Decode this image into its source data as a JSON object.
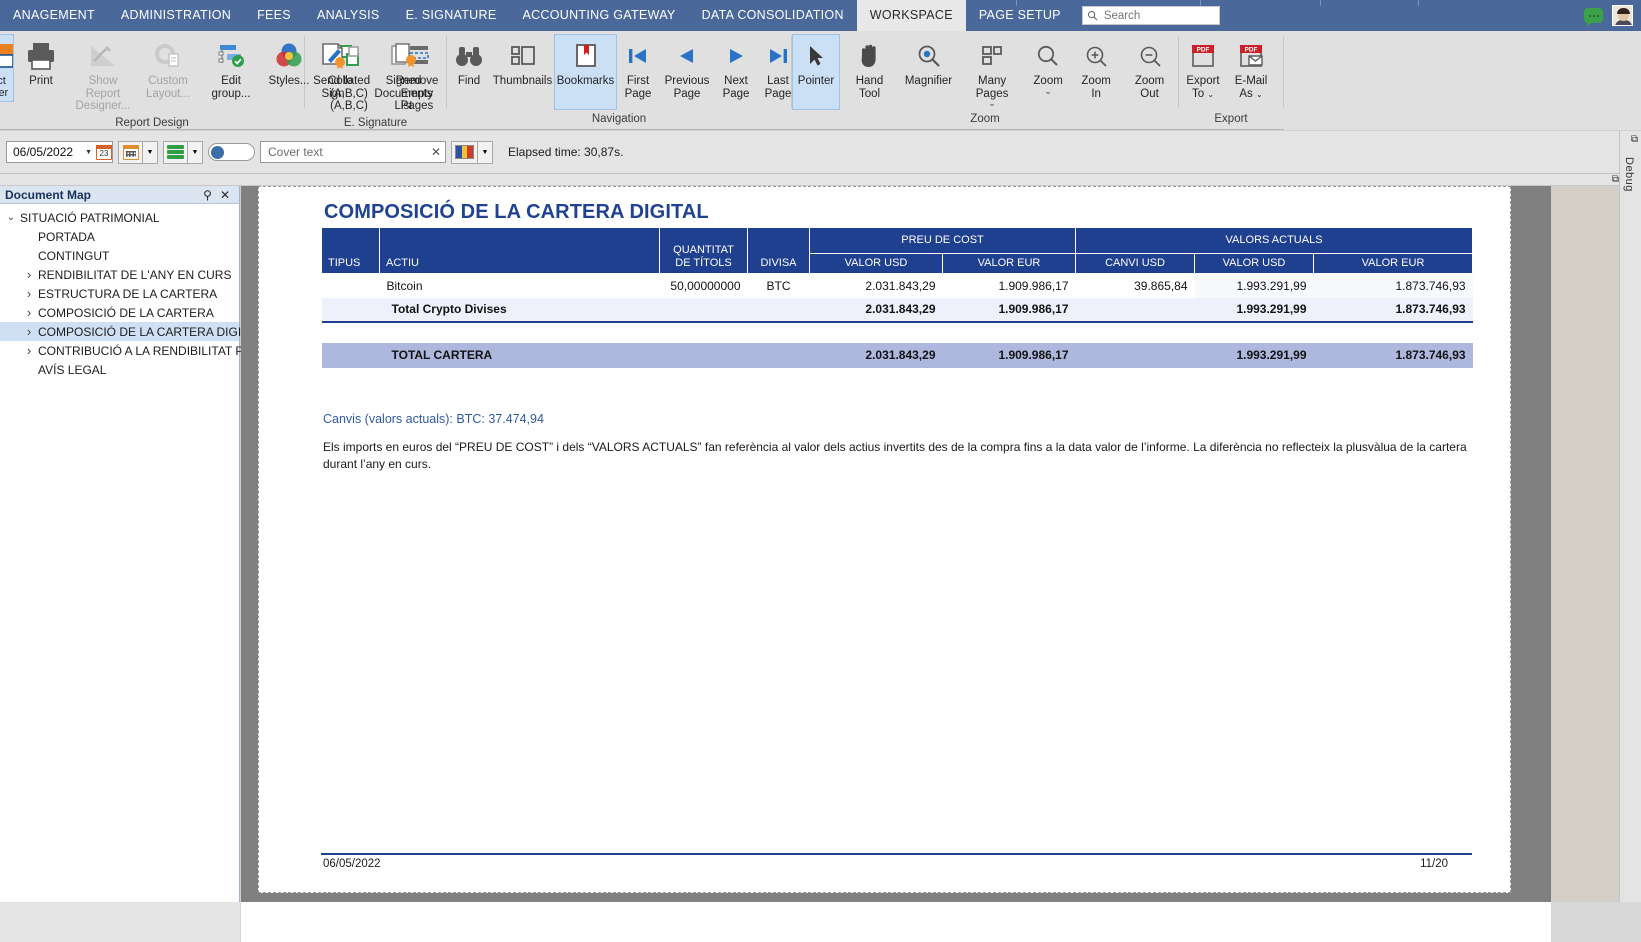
{
  "topbar": {
    "menu_items": [
      {
        "label": "ANAGEMENT",
        "active": false
      },
      {
        "label": "ADMINISTRATION",
        "active": false
      },
      {
        "label": "FEES",
        "active": false
      },
      {
        "label": "ANALYSIS",
        "active": false
      },
      {
        "label": "E. SIGNATURE",
        "active": false
      },
      {
        "label": "ACCOUNTING GATEWAY",
        "active": false
      },
      {
        "label": "DATA CONSOLIDATION",
        "active": false
      },
      {
        "label": "WORKSPACE",
        "active": true
      },
      {
        "label": "PAGE SETUP",
        "active": false
      }
    ],
    "search": {
      "placeholder": "Search",
      "value": "",
      "icon": "search-icon"
    },
    "chat_icon": "chat-bubble-icon",
    "avatar": "user-avatar",
    "bg_color": "#4a6899",
    "active_tab_bg": "#e8e8e8"
  },
  "ribbon": {
    "groups": [
      {
        "name": "report-design",
        "label": "Report Design",
        "buttons": [
          {
            "name": "select-printer",
            "label": "ct\nrer",
            "icon": "printer-select-icon",
            "state": "active",
            "cut_off": true
          },
          {
            "name": "print",
            "label": "Print",
            "icon": "printer-icon",
            "state": "normal"
          },
          {
            "name": "show-report-designer",
            "label": "Show Report\nDesigner...",
            "icon": "designer-icon",
            "state": "disabled"
          },
          {
            "name": "custom-layout",
            "label": "Custom\nLayout...",
            "icon": "gear-doc-icon",
            "state": "disabled"
          },
          {
            "name": "edit-group",
            "label": "Edit group...",
            "icon": "edit-group-icon",
            "state": "normal"
          },
          {
            "name": "styles",
            "label": "Styles...",
            "icon": "styles-venn-icon",
            "state": "normal"
          },
          {
            "name": "collated",
            "label": "Collated\n(A,B,C) (A,B,C)",
            "icon": "collated-icon",
            "state": "normal"
          },
          {
            "name": "remove-empty-pages",
            "label": "Remove\nEmpty Pages",
            "icon": "remove-pages-icon",
            "state": "normal"
          }
        ]
      },
      {
        "name": "e-signature",
        "label": "E. Signature",
        "buttons": [
          {
            "name": "send-to-sign",
            "label": "Send to\nSign",
            "icon": "sign-doc-icon",
            "state": "normal"
          },
          {
            "name": "signed-documents-list",
            "label": "Signed\nDocuments List",
            "icon": "signed-docs-icon",
            "state": "normal"
          }
        ]
      },
      {
        "name": "navigation",
        "label": "Navigation",
        "buttons": [
          {
            "name": "find",
            "label": "Find",
            "icon": "binoculars-icon",
            "state": "normal"
          },
          {
            "name": "thumbnails",
            "label": "Thumbnails",
            "icon": "thumbnails-icon",
            "state": "normal"
          },
          {
            "name": "bookmarks",
            "label": "Bookmarks",
            "icon": "bookmark-icon",
            "state": "active"
          },
          {
            "name": "first-page",
            "label": "First\nPage",
            "icon": "first-page-icon",
            "state": "normal"
          },
          {
            "name": "previous-page",
            "label": "Previous\nPage",
            "icon": "previous-page-icon",
            "state": "normal"
          },
          {
            "name": "next-page",
            "label": "Next\nPage",
            "icon": "next-page-icon",
            "state": "normal"
          },
          {
            "name": "last-page",
            "label": "Last\nPage",
            "icon": "last-page-icon",
            "state": "normal"
          }
        ]
      },
      {
        "name": "zoom",
        "label": "Zoom",
        "buttons": [
          {
            "name": "pointer",
            "label": "Pointer",
            "icon": "pointer-icon",
            "state": "active"
          },
          {
            "name": "hand-tool",
            "label": "Hand Tool",
            "icon": "hand-icon",
            "state": "normal"
          },
          {
            "name": "magnifier",
            "label": "Magnifier",
            "icon": "magnifier-icon",
            "state": "normal"
          },
          {
            "name": "many-pages",
            "label": "Many Pages",
            "icon": "many-pages-icon",
            "state": "normal",
            "dropdown": true
          },
          {
            "name": "zoom-level",
            "label": "Zoom",
            "icon": "zoom-icon",
            "state": "normal",
            "dropdown": true
          },
          {
            "name": "zoom-in",
            "label": "Zoom In",
            "icon": "zoom-in-icon",
            "state": "normal"
          },
          {
            "name": "zoom-out",
            "label": "Zoom Out",
            "icon": "zoom-out-icon",
            "state": "normal"
          }
        ]
      },
      {
        "name": "export",
        "label": "Export",
        "buttons": [
          {
            "name": "export-to",
            "label": "Export\nTo",
            "icon": "pdf-export-icon",
            "state": "normal",
            "dropdown": true
          },
          {
            "name": "email-as",
            "label": "E-Mail\nAs",
            "icon": "pdf-email-icon",
            "state": "normal",
            "dropdown": true
          }
        ]
      }
    ]
  },
  "toolbar2": {
    "date_value": "06/05/2022",
    "date_icon": "calendar-23-icon",
    "calendar_button_icon": "calendar-icon",
    "layers_button_icon": "layers-icon",
    "toggle_state": "off",
    "cover_text_placeholder": "Cover text",
    "cover_text_value": "",
    "clear_icon": "close-icon",
    "flag_icon": "flag-andorra-icon",
    "elapsed_label": "Elapsed time: 30,87s."
  },
  "document_map": {
    "title": "Document Map",
    "pin_icon": "pin-icon",
    "close_icon": "close-icon",
    "items": [
      {
        "label": "SITUACIÓ PATRIMONIAL",
        "level": 1,
        "twisty": "expanded",
        "selected": false
      },
      {
        "label": "PORTADA",
        "level": 2,
        "twisty": "none",
        "selected": false
      },
      {
        "label": "CONTINGUT",
        "level": 2,
        "twisty": "none",
        "selected": false
      },
      {
        "label": "RENDIBILITAT DE L'ANY EN CURS",
        "level": 2,
        "twisty": "collapsed",
        "selected": false
      },
      {
        "label": "ESTRUCTURA DE LA CARTERA",
        "level": 2,
        "twisty": "collapsed",
        "selected": false
      },
      {
        "label": "COMPOSICIÓ DE LA CARTERA",
        "level": 2,
        "twisty": "collapsed",
        "selected": false
      },
      {
        "label": "COMPOSICIÓ DE LA CARTERA DIGITAL",
        "level": 2,
        "twisty": "collapsed",
        "selected": true
      },
      {
        "label": "CONTRIBUCIÓ A LA RENDIBILITAT PER...",
        "level": 2,
        "twisty": "collapsed",
        "selected": false
      },
      {
        "label": "AVÍS LEGAL",
        "level": 2,
        "twisty": "none",
        "selected": false
      }
    ]
  },
  "report": {
    "title": "COMPOSICIÓ DE LA CARTERA DIGITAL",
    "title_color": "#1f4291",
    "header_bg": "#1f3f8f",
    "group_headers": [
      {
        "label": "PREU DE COST",
        "span": 2
      },
      {
        "label": "VALORS ACTUALS",
        "span": 3
      }
    ],
    "columns": [
      "TIPUS",
      "ACTIU",
      "QUANTITAT DE TÍTOLS",
      "DIVISA",
      "VALOR USD",
      "VALOR EUR",
      "CANVI USD",
      "VALOR USD",
      "VALOR EUR"
    ],
    "rows": [
      {
        "kind": "data",
        "tipus": "",
        "actiu": "Bitcoin",
        "quantitat": "50,00000000",
        "divisa": "BTC",
        "cost_usd": "2.031.843,29",
        "cost_eur": "1.909.986,17",
        "canvi_usd": "39.865,84",
        "actual_usd": "1.993.291,99",
        "actual_eur": "1.873.746,93"
      },
      {
        "kind": "subtotal",
        "tipus": "",
        "actiu": "Total Crypto Divises",
        "quantitat": "",
        "divisa": "",
        "cost_usd": "2.031.843,29",
        "cost_eur": "1.909.986,17",
        "canvi_usd": "",
        "actual_usd": "1.993.291,99",
        "actual_eur": "1.873.746,93"
      },
      {
        "kind": "grand",
        "tipus": "",
        "actiu": "TOTAL CARTERA",
        "quantitat": "",
        "divisa": "",
        "cost_usd": "2.031.843,29",
        "cost_eur": "1.909.986,17",
        "canvi_usd": "",
        "actual_usd": "1.993.291,99",
        "actual_eur": "1.873.746,93"
      }
    ],
    "exchange_note": "Canvis (valors actuals): BTC: 37.474,94",
    "disclaimer": "Els imports en euros del “PREU DE COST” i dels “VALORS ACTUALS” fan referència al valor dels actius invertits des de la compra fins a la data valor de l’informe. La diferència no reflecteix la plusvàlua de la cartera durant l’any en curs.",
    "footer_date": "06/05/2022",
    "footer_page": "11/20"
  },
  "right_rail": {
    "debug_label": "Debug",
    "restore_icon": "restore-icon",
    "close_icon": "close-icon"
  }
}
